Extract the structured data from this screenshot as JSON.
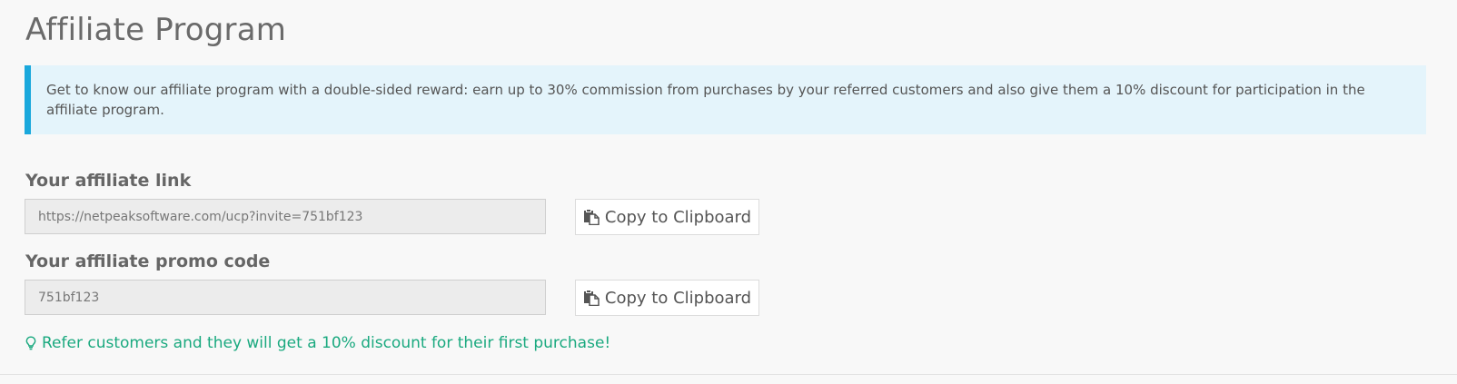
{
  "page": {
    "title": "Affiliate Program"
  },
  "info": {
    "text": "Get to know our affiliate program with a double-sided reward: earn up to 30% commission from purchases by your referred customers and also give them a 10% discount for participation in the affiliate program."
  },
  "affiliate_link": {
    "label": "Your affiliate link",
    "value": "https://netpeaksoftware.com/ucp?invite=751bf123",
    "copy_label": "Copy to Clipboard"
  },
  "promo_code": {
    "label": "Your affiliate promo code",
    "value": "751bf123",
    "copy_label": "Copy to Clipboard"
  },
  "tip": {
    "icon": "lightbulb-icon",
    "text": "Refer customers and they will get a 10% discount for their first purchase!"
  },
  "colors": {
    "accent_blue": "#1aa8dc",
    "info_background": "#e4f4fb",
    "tip_green": "#1aa97f"
  }
}
